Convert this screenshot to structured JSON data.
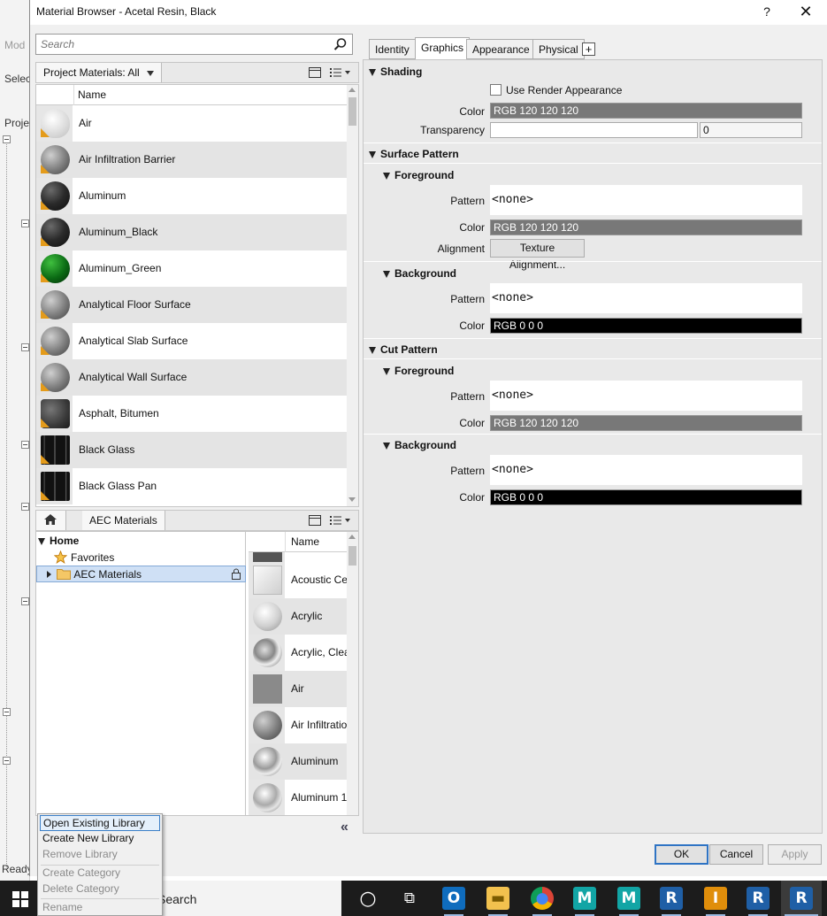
{
  "background_app": {
    "labels": [
      "Mod",
      "Selec",
      "Projec"
    ],
    "status": "Ready"
  },
  "taskbar": {
    "search_text": "Search",
    "apps": [
      {
        "name": "cortana",
        "glyph": "○"
      },
      {
        "name": "task-view",
        "glyph": "⧉"
      },
      {
        "name": "outlook",
        "glyph": "O"
      },
      {
        "name": "file-explorer",
        "glyph": "▬"
      },
      {
        "name": "chrome",
        "glyph": "●"
      },
      {
        "name": "maya-2019",
        "glyph": "M"
      },
      {
        "name": "maya-2018",
        "glyph": "M"
      },
      {
        "name": "revit-a",
        "glyph": "R"
      },
      {
        "name": "inventor",
        "glyph": "I"
      },
      {
        "name": "revit-b",
        "glyph": "R"
      },
      {
        "name": "revit-active",
        "glyph": "R"
      }
    ]
  },
  "dialog": {
    "title": "Material Browser - Acetal Resin, Black",
    "help": "?",
    "close": "✕"
  },
  "search": {
    "placeholder": "Search"
  },
  "project_bar": {
    "label": "Project Materials: All"
  },
  "project_list": {
    "column": "Name",
    "rows": [
      {
        "name": "Air",
        "thumb": "air"
      },
      {
        "name": "Air Infiltration Barrier",
        "thumb": "grey-cut"
      },
      {
        "name": "Aluminum",
        "thumb": "dark"
      },
      {
        "name": "Aluminum_Black",
        "thumb": "dark"
      },
      {
        "name": "Aluminum_Green",
        "thumb": "green"
      },
      {
        "name": "Analytical Floor Surface",
        "thumb": "grey-cut"
      },
      {
        "name": "Analytical Slab Surface",
        "thumb": "grey-cut"
      },
      {
        "name": "Analytical Wall Surface",
        "thumb": "grey-cut"
      },
      {
        "name": "Asphalt, Bitumen",
        "thumb": "asphalt"
      },
      {
        "name": "Black Glass",
        "thumb": "glass"
      },
      {
        "name": "Black Glass Pan",
        "thumb": "glass"
      }
    ]
  },
  "library_bar": {
    "label": "AEC Materials"
  },
  "library_tree": {
    "home": "Home",
    "favorites": "Favorites",
    "aec": "AEC Materials"
  },
  "library_list": {
    "column": "Name",
    "rows": [
      {
        "name": "Acoustic Ce"
      },
      {
        "name": "Acrylic"
      },
      {
        "name": "Acrylic, Clea"
      },
      {
        "name": "Air"
      },
      {
        "name": "Air Infiltratio"
      },
      {
        "name": "Aluminum"
      },
      {
        "name": "Aluminum 1"
      }
    ]
  },
  "context_menu": {
    "open_existing": "Open Existing Library",
    "create_new": "Create New Library",
    "remove": "Remove Library",
    "create_category": "Create Category",
    "delete_category": "Delete Category",
    "rename": "Rename"
  },
  "tabs": {
    "identity": "Identity",
    "graphics": "Graphics",
    "appearance": "Appearance",
    "physical": "Physical",
    "add": "+"
  },
  "graphics": {
    "shading": {
      "title": "Shading",
      "use_render": "Use Render Appearance",
      "color_label": "Color",
      "color_value": "RGB 120 120 120",
      "transparency_label": "Transparency",
      "transparency_value": "0"
    },
    "surface_pattern": {
      "title": "Surface Pattern",
      "fg_title": "Foreground",
      "fg_pattern_label": "Pattern",
      "fg_pattern": "<none>",
      "fg_color_label": "Color",
      "fg_color": "RGB 120 120 120",
      "alignment_label": "Alignment",
      "alignment_button": "Texture Alignment...",
      "bg_title": "Background",
      "bg_pattern_label": "Pattern",
      "bg_pattern": "<none>",
      "bg_color_label": "Color",
      "bg_color": "RGB 0 0 0"
    },
    "cut_pattern": {
      "title": "Cut Pattern",
      "fg_title": "Foreground",
      "fg_pattern_label": "Pattern",
      "fg_pattern": "<none>",
      "fg_color_label": "Color",
      "fg_color": "RGB 120 120 120",
      "bg_title": "Background",
      "bg_pattern_label": "Pattern",
      "bg_pattern": "<none>",
      "bg_color_label": "Color",
      "bg_color": "RGB 0 0 0"
    }
  },
  "footer": {
    "ok": "OK",
    "cancel": "Cancel",
    "apply": "Apply"
  },
  "colors": {
    "grey_swatch": "#787878",
    "black_swatch": "#000000",
    "accent": "#2f74c4",
    "badge": "#e49b1a"
  }
}
